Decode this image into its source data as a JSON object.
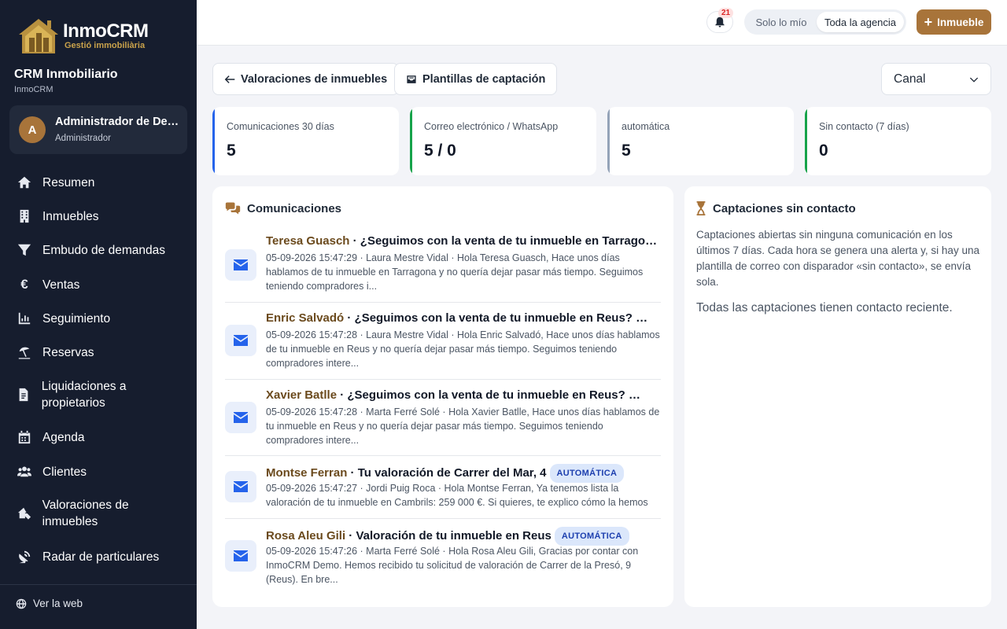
{
  "brand": {
    "name": "InmoCRM",
    "tagline": "Gestió immobiliària"
  },
  "sidebar": {
    "app_title": "CRM Inmobiliario",
    "app_subtitle": "InmoCRM",
    "user": {
      "initial": "A",
      "name": "Administrador de Demo",
      "role": "Administrador"
    },
    "items": [
      {
        "label": "Resumen",
        "icon": "home-icon"
      },
      {
        "label": "Inmuebles",
        "icon": "building-icon"
      },
      {
        "label": "Embudo de demandas",
        "icon": "filter-icon"
      },
      {
        "label": "Ventas",
        "icon": "euro-icon"
      },
      {
        "label": "Seguimiento",
        "icon": "chart-icon"
      },
      {
        "label": "Reservas",
        "icon": "umbrella-beach-icon"
      },
      {
        "label": "Liquidaciones a propietarios",
        "icon": "invoice-icon"
      },
      {
        "label": "Agenda",
        "icon": "calendar-icon"
      },
      {
        "label": "Clientes",
        "icon": "users-icon"
      },
      {
        "label": "Valoraciones de inmuebles",
        "icon": "house-tag-icon"
      },
      {
        "label": "Radar de particulares",
        "icon": "satellite-dish-icon"
      }
    ],
    "web_link": "Ver la web"
  },
  "topbar": {
    "notifications_count": "21",
    "scope_options": [
      "Solo lo mío",
      "Toda la agencia"
    ],
    "scope_selected": "Toda la agencia",
    "add_button": "Inmueble"
  },
  "toolbar": {
    "back_button": "Valoraciones de inmuebles",
    "templates_button": "Plantillas de captación",
    "channel_select": "Canal"
  },
  "stats": [
    {
      "label": "Comunicaciones 30 días",
      "value": "5",
      "accent": "#2563eb"
    },
    {
      "label": "Correo electrónico / WhatsApp",
      "value": "5 / 0",
      "accent": "#16a34a"
    },
    {
      "label": "automática",
      "value": "5",
      "accent": "#94a3b8"
    },
    {
      "label": "Sin contacto (7 días)",
      "value": "0",
      "accent": "#16a34a"
    }
  ],
  "communications": {
    "title": "Comunicaciones",
    "items": [
      {
        "name": "Teresa Guasch",
        "subject": " · ¿Seguimos con la venta de tu inmueble en Tarragona…",
        "badge": "",
        "body": "05-09-2026 15:47:29 · Laura Mestre Vidal · Hola Teresa Guasch, Hace unos días hablamos de tu inmueble en Tarragona y no quería dejar pasar más tiempo. Seguimos teniendo compradores i..."
      },
      {
        "name": "Enric Salvadó",
        "subject": " · ¿Seguimos con la venta de tu inmueble en Reus? …",
        "badge": "",
        "body": "05-09-2026 15:47:28 · Laura Mestre Vidal · Hola Enric Salvadó, Hace unos días hablamos de tu inmueble en Reus y no quería dejar pasar más tiempo. Seguimos teniendo compradores intere..."
      },
      {
        "name": "Xavier Batlle",
        "subject": " · ¿Seguimos con la venta de tu inmueble en Reus? …",
        "badge": "",
        "body": "05-09-2026 15:47:28 · Marta Ferré Solé · Hola Xavier Batlle, Hace unos días hablamos de tu inmueble en Reus y no quería dejar pasar más tiempo. Seguimos teniendo compradores intere..."
      },
      {
        "name": "Montse Ferran",
        "subject": " · Tu valoración de Carrer del Mar, 4",
        "badge": "AUTOMÁTICA",
        "body": "05-09-2026 15:47:27 · Jordi Puig Roca · Hola Montse Ferran, Ya tenemos lista la valoración de tu inmueble en Cambrils: 259 000 €. Si quieres, te explico cómo la hemos calculado y ..."
      },
      {
        "name": "Rosa Aleu Gili",
        "subject": " · Valoración de tu inmueble en Reus",
        "badge": "AUTOMÁTICA",
        "body": "05-09-2026 15:47:26 · Marta Ferré Solé · Hola Rosa Aleu Gili, Gracias por contar con InmoCRM Demo. Hemos recibido tu solicitud de valoración de Carrer de la Presó, 9 (Reus). En bre..."
      }
    ]
  },
  "uncontacted": {
    "title": "Captaciones sin contacto",
    "description": "Captaciones abiertas sin ninguna comunicación en los últimos 7 días. Cada hora se genera una alerta y, si hay una plantilla de correo con disparador «sin contacto», se envía sola.",
    "empty": "Todas las captaciones tienen contacto reciente."
  }
}
